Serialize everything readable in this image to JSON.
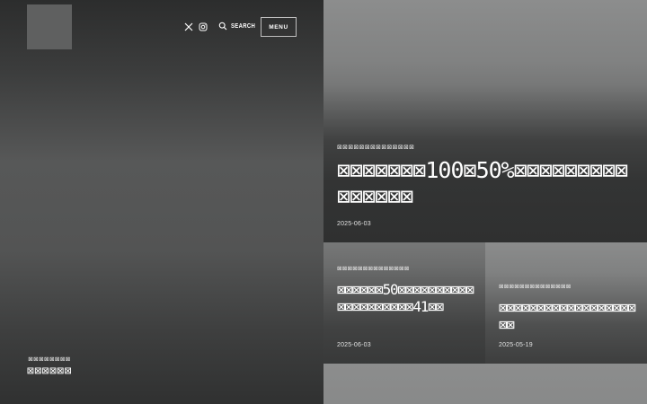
{
  "hero": {
    "subtitle": "⊠⊠⊠⊠⊠⊠⊠⊠",
    "title": "⊠⊠⊠⊠⊠⊠"
  },
  "header": {
    "social_icons": [
      "x-icon",
      "instagram-icon"
    ],
    "search_label": "SEARCH",
    "menu_label": "MENU"
  },
  "articles": [
    {
      "category": "⊠⊠⊠⊠⊠⊠⊠⊠⊠⊠⊠⊠⊠⊠",
      "title": "⊠⊠⊠⊠⊠⊠⊠100⊠50%⊠⊠⊠⊠⊠⊠⊠⊠⊠⊠⊠⊠⊠⊠⊠",
      "date": "2025-06-03"
    },
    {
      "category": "⊠⊠⊠⊠⊠⊠⊠⊠⊠⊠⊠⊠⊠⊠",
      "title": "⊠⊠⊠⊠⊠⊠50⊠⊠⊠⊠⊠⊠⊠⊠⊠⊠⊠⊠⊠⊠⊠⊠⊠⊠⊠⊠41⊠⊠",
      "date": "2025-06-03"
    },
    {
      "category": "⊠⊠⊠⊠⊠⊠⊠⊠⊠⊠⊠⊠⊠⊠",
      "title": "⊠⊠⊠⊠⊠⊠⊠⊠⊠⊠⊠⊠⊠⊠⊠⊠⊠⊠⊠⊠",
      "date": "2025-05-19"
    }
  ]
}
